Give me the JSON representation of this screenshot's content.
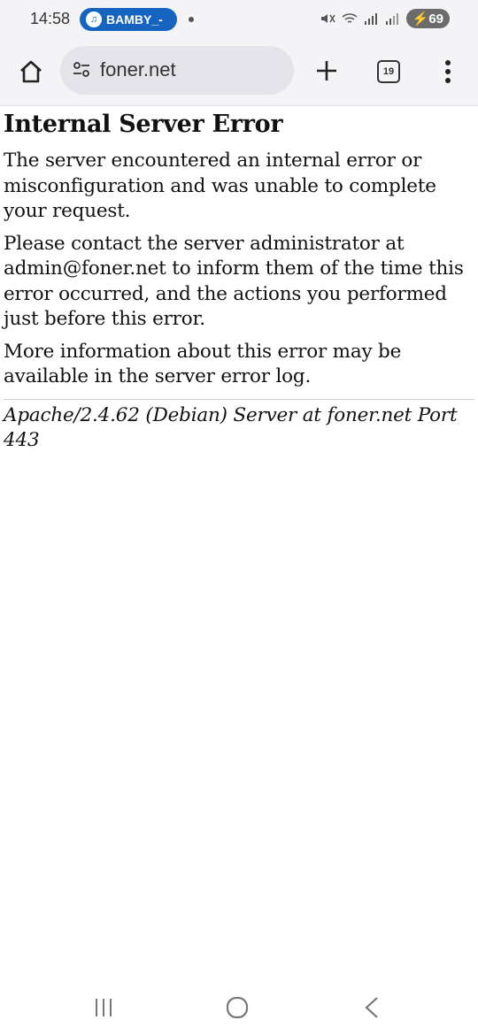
{
  "status": {
    "time": "14:58",
    "pill_label": "BAMBY_-",
    "battery": "69"
  },
  "toolbar": {
    "url": "foner.net",
    "tab_count": "19"
  },
  "page": {
    "title": "Internal Server Error",
    "paragraph1": "The server encountered an internal error or misconfiguration and was unable to complete your request.",
    "paragraph2": "Please contact the server administrator at admin@foner.net to inform them of the time this error occurred, and the actions you performed just before this error.",
    "paragraph3": "More information about this error may be available in the server error log.",
    "signature": "Apache/2.4.62 (Debian) Server at foner.net Port 443"
  },
  "icons": {
    "home": "home-icon",
    "site_settings": "tune-icon",
    "new_tab": "plus-icon",
    "tabs": "tab-switcher-icon",
    "menu": "more-vert-icon",
    "nav_recents": "recents-icon",
    "nav_home": "home-circle-icon",
    "nav_back": "back-icon"
  },
  "colors": {
    "pill": "#1565c0",
    "toolbar_bg": "#f4f4f7",
    "url_bg": "#e4e4ea"
  }
}
